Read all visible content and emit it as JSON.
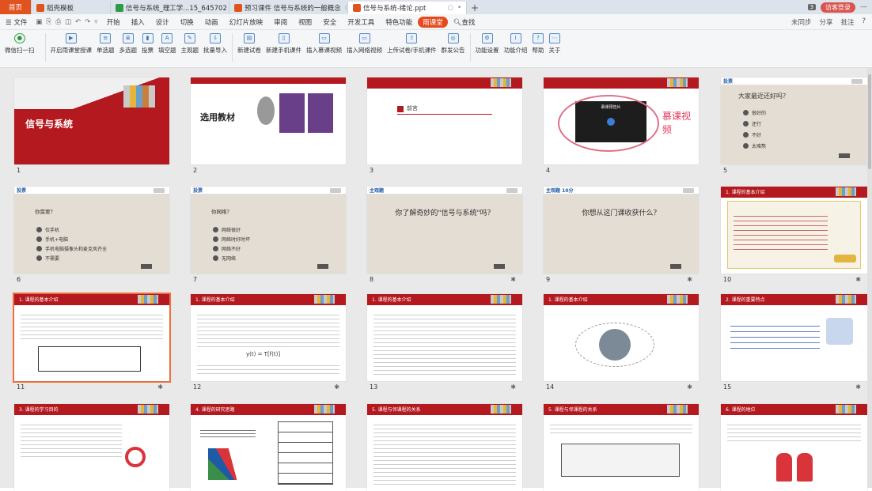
{
  "tabs": [
    {
      "label": "首页",
      "kind": "home"
    },
    {
      "label": "稻壳模板",
      "icon_color": "#e0531f",
      "closable": false
    },
    {
      "label": "信号与系统_理工学...15_645702",
      "icon_color": "#2c9b4a",
      "closable": false
    },
    {
      "label": "预习课件 信号与系统的一般概念",
      "icon_color": "#e0531f",
      "closable": false
    },
    {
      "label": "信号与系统-绪论.ppt",
      "icon_color": "#e0531f",
      "active": true,
      "closable": true
    }
  ],
  "tab_right": {
    "count_badge": "3",
    "visitor_label": "访客登录",
    "minimize": "—"
  },
  "menu": {
    "file": "文件",
    "items": [
      "开始",
      "插入",
      "设计",
      "切换",
      "动画",
      "幻灯片放映",
      "审阅",
      "视图",
      "安全",
      "开发工具",
      "特色功能"
    ],
    "ketang": "雨课堂",
    "search": "查找",
    "right": [
      "未同步",
      "分享",
      "批注",
      "?"
    ]
  },
  "ribbon": [
    {
      "label": "微信扫一扫",
      "icon": "wechat-icon"
    },
    {
      "label": "开启雨课堂授课",
      "icon": "start-class-icon"
    },
    {
      "label": "单选题",
      "icon": "single-choice-icon"
    },
    {
      "label": "多选题",
      "icon": "multi-choice-icon"
    },
    {
      "label": "投票",
      "icon": "vote-icon"
    },
    {
      "label": "填空题",
      "icon": "fill-blank-icon"
    },
    {
      "label": "主观题",
      "icon": "subjective-icon"
    },
    {
      "label": "批量导入",
      "icon": "batch-import-icon"
    },
    {
      "label": "新建试卷",
      "icon": "new-paper-icon"
    },
    {
      "label": "新建手机课件",
      "icon": "new-mobile-courseware-icon"
    },
    {
      "label": "插入慕课视频",
      "icon": "mooc-video-icon"
    },
    {
      "label": "插入网络视频",
      "icon": "web-video-icon"
    },
    {
      "label": "上传试卷/手机课件",
      "icon": "upload-icon"
    },
    {
      "label": "群发公告",
      "icon": "announce-icon"
    },
    {
      "label": "功能设置",
      "icon": "settings-icon"
    },
    {
      "label": "功能介绍",
      "icon": "intro-icon"
    },
    {
      "label": "帮助",
      "icon": "help-icon"
    },
    {
      "label": "关于",
      "icon": "about-icon"
    }
  ],
  "slides": [
    {
      "n": "1",
      "title": "信号与系统"
    },
    {
      "n": "2",
      "title": "选用教材"
    },
    {
      "n": "3",
      "title": "前言"
    },
    {
      "n": "4",
      "annotation": "慕课视频",
      "video_title": "慕课预告片"
    },
    {
      "n": "5",
      "tag": "投票",
      "q": "大家最近还好吗？",
      "opts": [
        "很好的",
        "还行",
        "不好",
        "太难熬"
      ]
    },
    {
      "n": "6",
      "tag": "投票",
      "q": "你需要？",
      "opts": [
        "仅手机",
        "手机+电脑",
        "手机电脑摄像头和麦克风齐全",
        "不需要"
      ]
    },
    {
      "n": "7",
      "tag": "投票",
      "q": "你网络？",
      "opts": [
        "网络很好",
        "网络时好时坏",
        "网络不好",
        "无网络"
      ]
    },
    {
      "n": "8",
      "tag": "主观题",
      "q": "你了解奇妙的\"信号与系统\"吗？",
      "star": true
    },
    {
      "n": "9",
      "tag": "主观题 10分",
      "q": "你想从这门课收获什么？",
      "star": true
    },
    {
      "n": "10",
      "header": "1. 课程的基本介绍",
      "star": true
    },
    {
      "n": "11",
      "header": "1. 课程的基本介绍",
      "selected": true,
      "star": true
    },
    {
      "n": "12",
      "header": "1. 课程的基本介绍",
      "star": true
    },
    {
      "n": "13",
      "header": "1. 课程的基本介绍",
      "star": true
    },
    {
      "n": "14",
      "header": "1. 课程的基本介绍",
      "star": true
    },
    {
      "n": "15",
      "header": "2. 课程的重要特点",
      "star": true
    },
    {
      "n": "16",
      "header": "3. 课程的学习目的"
    },
    {
      "n": "17",
      "header": "4. 课程的研究思路"
    },
    {
      "n": "18",
      "header": "5. 课程与邻课程的关系"
    },
    {
      "n": "19",
      "header": "5. 课程与邻课程的关系"
    },
    {
      "n": "20",
      "header": "6. 课程的地位"
    }
  ]
}
